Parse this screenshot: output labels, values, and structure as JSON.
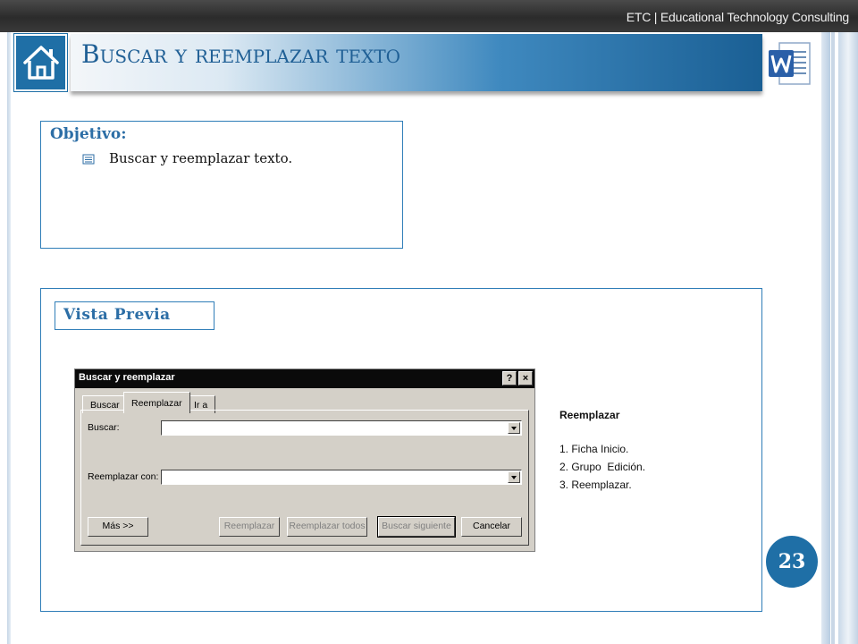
{
  "header": {
    "brand": "ETC | Educational Technology Consulting",
    "title": "Buscar y reemplazar texto"
  },
  "icons": {
    "home": "home-icon",
    "app": "word-icon",
    "bullet": "list-bullet-icon"
  },
  "objective": {
    "heading": "Objetivo:",
    "items": [
      "Buscar y reemplazar texto."
    ]
  },
  "preview": {
    "label": "Vista Previa",
    "dialog": {
      "title": "Buscar y reemplazar",
      "help": "?",
      "close": "×",
      "tabs": [
        {
          "label": "Buscar",
          "active": false
        },
        {
          "label": "Reemplazar",
          "active": true
        },
        {
          "label": "Ir a",
          "active": false
        }
      ],
      "find_label": "Buscar:",
      "find_value": "",
      "replace_label": "Reemplazar con:",
      "replace_value": "",
      "buttons": {
        "more": "Más >>",
        "replace": "Reemplazar",
        "replace_all": "Reemplazar todos",
        "find_next": "Buscar siguiente",
        "cancel": "Cancelar"
      }
    },
    "notes": {
      "heading": "Reemplazar",
      "steps": [
        "1. Ficha Inicio.",
        "2. Grupo  Edición.",
        "3. Reemplazar."
      ]
    }
  },
  "page_number": "23",
  "colors": {
    "accent": "#1f6fa6",
    "title_text": "#1f5f95",
    "border": "#2f7db8"
  }
}
